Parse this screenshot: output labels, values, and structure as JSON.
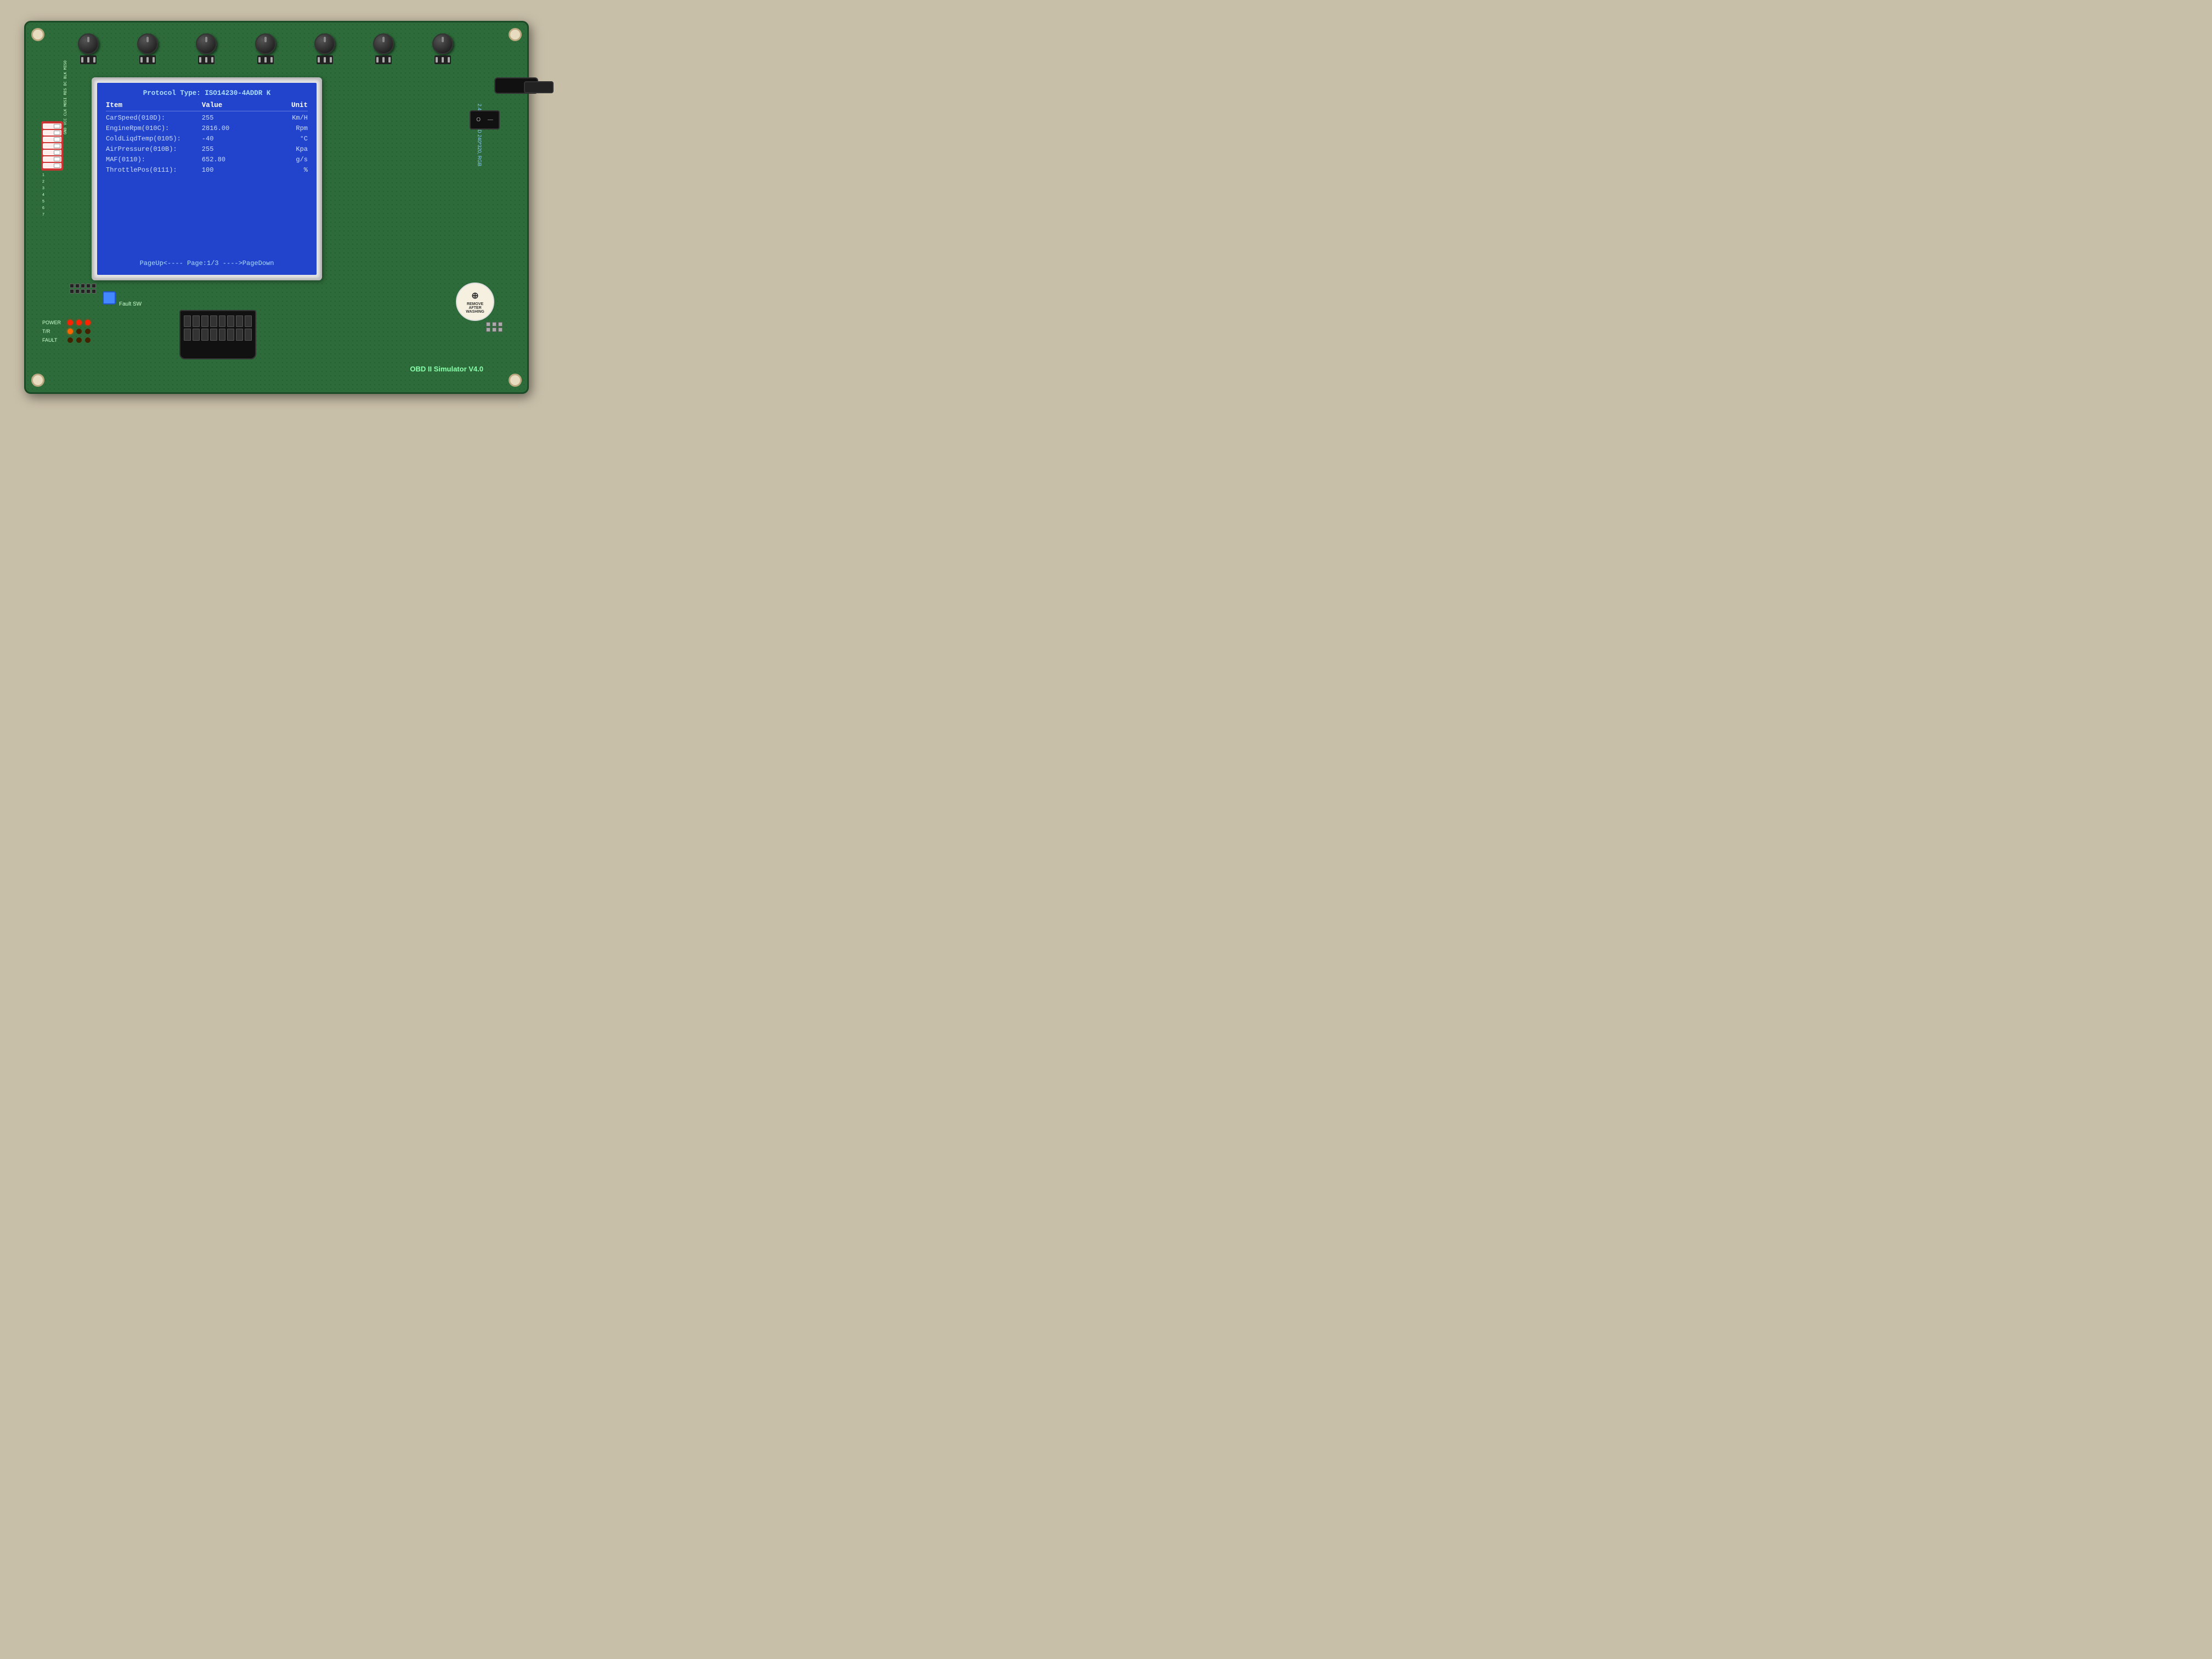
{
  "board": {
    "title": "OBD II Simulator V4.0",
    "tft_label": "2.4'TFT_LCD 240*320, RGB"
  },
  "lcd": {
    "protocol_label": "Protocol Type:",
    "protocol_value": "ISO14230-4ADDR K",
    "headers": {
      "item": "Item",
      "value": "Value",
      "unit": "Unit"
    },
    "rows": [
      {
        "item": "CarSpeed(010D):",
        "value": "255",
        "unit": "Km/H"
      },
      {
        "item": "EngineRpm(010C):",
        "value": "2816.00",
        "unit": "Rpm"
      },
      {
        "item": "ColdLiqdTemp(0105):",
        "value": "-40",
        "unit": "°C"
      },
      {
        "item": "AirPressure(010B):",
        "value": "255",
        "unit": "Kpa"
      },
      {
        "item": "MAF(0110):",
        "value": "652.80",
        "unit": "g/s"
      },
      {
        "item": "ThrottlePos(0111):",
        "value": "100",
        "unit": "%"
      }
    ],
    "footer": "PageUp<---- Page:1/3 ---->PageDown"
  },
  "leds": [
    {
      "label": "POWER",
      "states": [
        "red",
        "red",
        "red"
      ]
    },
    {
      "label": "T/R",
      "states": [
        "orange",
        "off",
        "off"
      ]
    },
    {
      "label": "FAULT",
      "states": [
        "off",
        "off",
        "off"
      ]
    }
  ],
  "dip": {
    "labels": [
      "1",
      "2",
      "3",
      "4",
      "5",
      "6",
      "7"
    ]
  },
  "sticker": {
    "line1": "REMOVE",
    "line2": "AFTER",
    "line3": "WASHING"
  },
  "fault_sw": {
    "label": "Fault SW"
  }
}
